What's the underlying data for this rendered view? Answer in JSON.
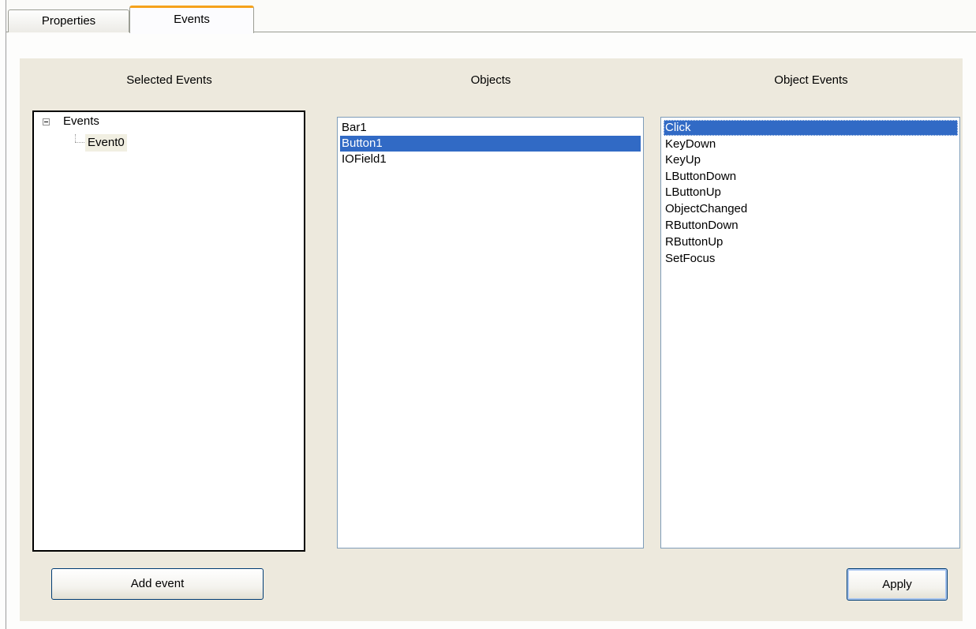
{
  "tabs": [
    {
      "label": "Properties",
      "active": false
    },
    {
      "label": "Events",
      "active": true
    }
  ],
  "headings": {
    "selected_events": "Selected Events",
    "objects": "Objects",
    "object_events": "Object Events"
  },
  "tree": {
    "root": {
      "label": "Events",
      "expanded": true,
      "icon": "collapse-minus-icon"
    },
    "children": [
      {
        "label": "Event0",
        "selected": true
      }
    ]
  },
  "objects": {
    "items": [
      "Bar1",
      "Button1",
      "IOField1"
    ],
    "selected": "Button1"
  },
  "object_events": {
    "items": [
      "Click",
      "KeyDown",
      "KeyUp",
      "LButtonDown",
      "LButtonUp",
      "ObjectChanged",
      "RButtonDown",
      "RButtonUp",
      "SetFocus"
    ],
    "selected": "Click"
  },
  "buttons": {
    "add_event": "Add event",
    "apply": "Apply"
  },
  "colors": {
    "selection": "#316ac5",
    "panel_background": "#ede9dd",
    "active_tab_accent": "#f5a21a"
  }
}
